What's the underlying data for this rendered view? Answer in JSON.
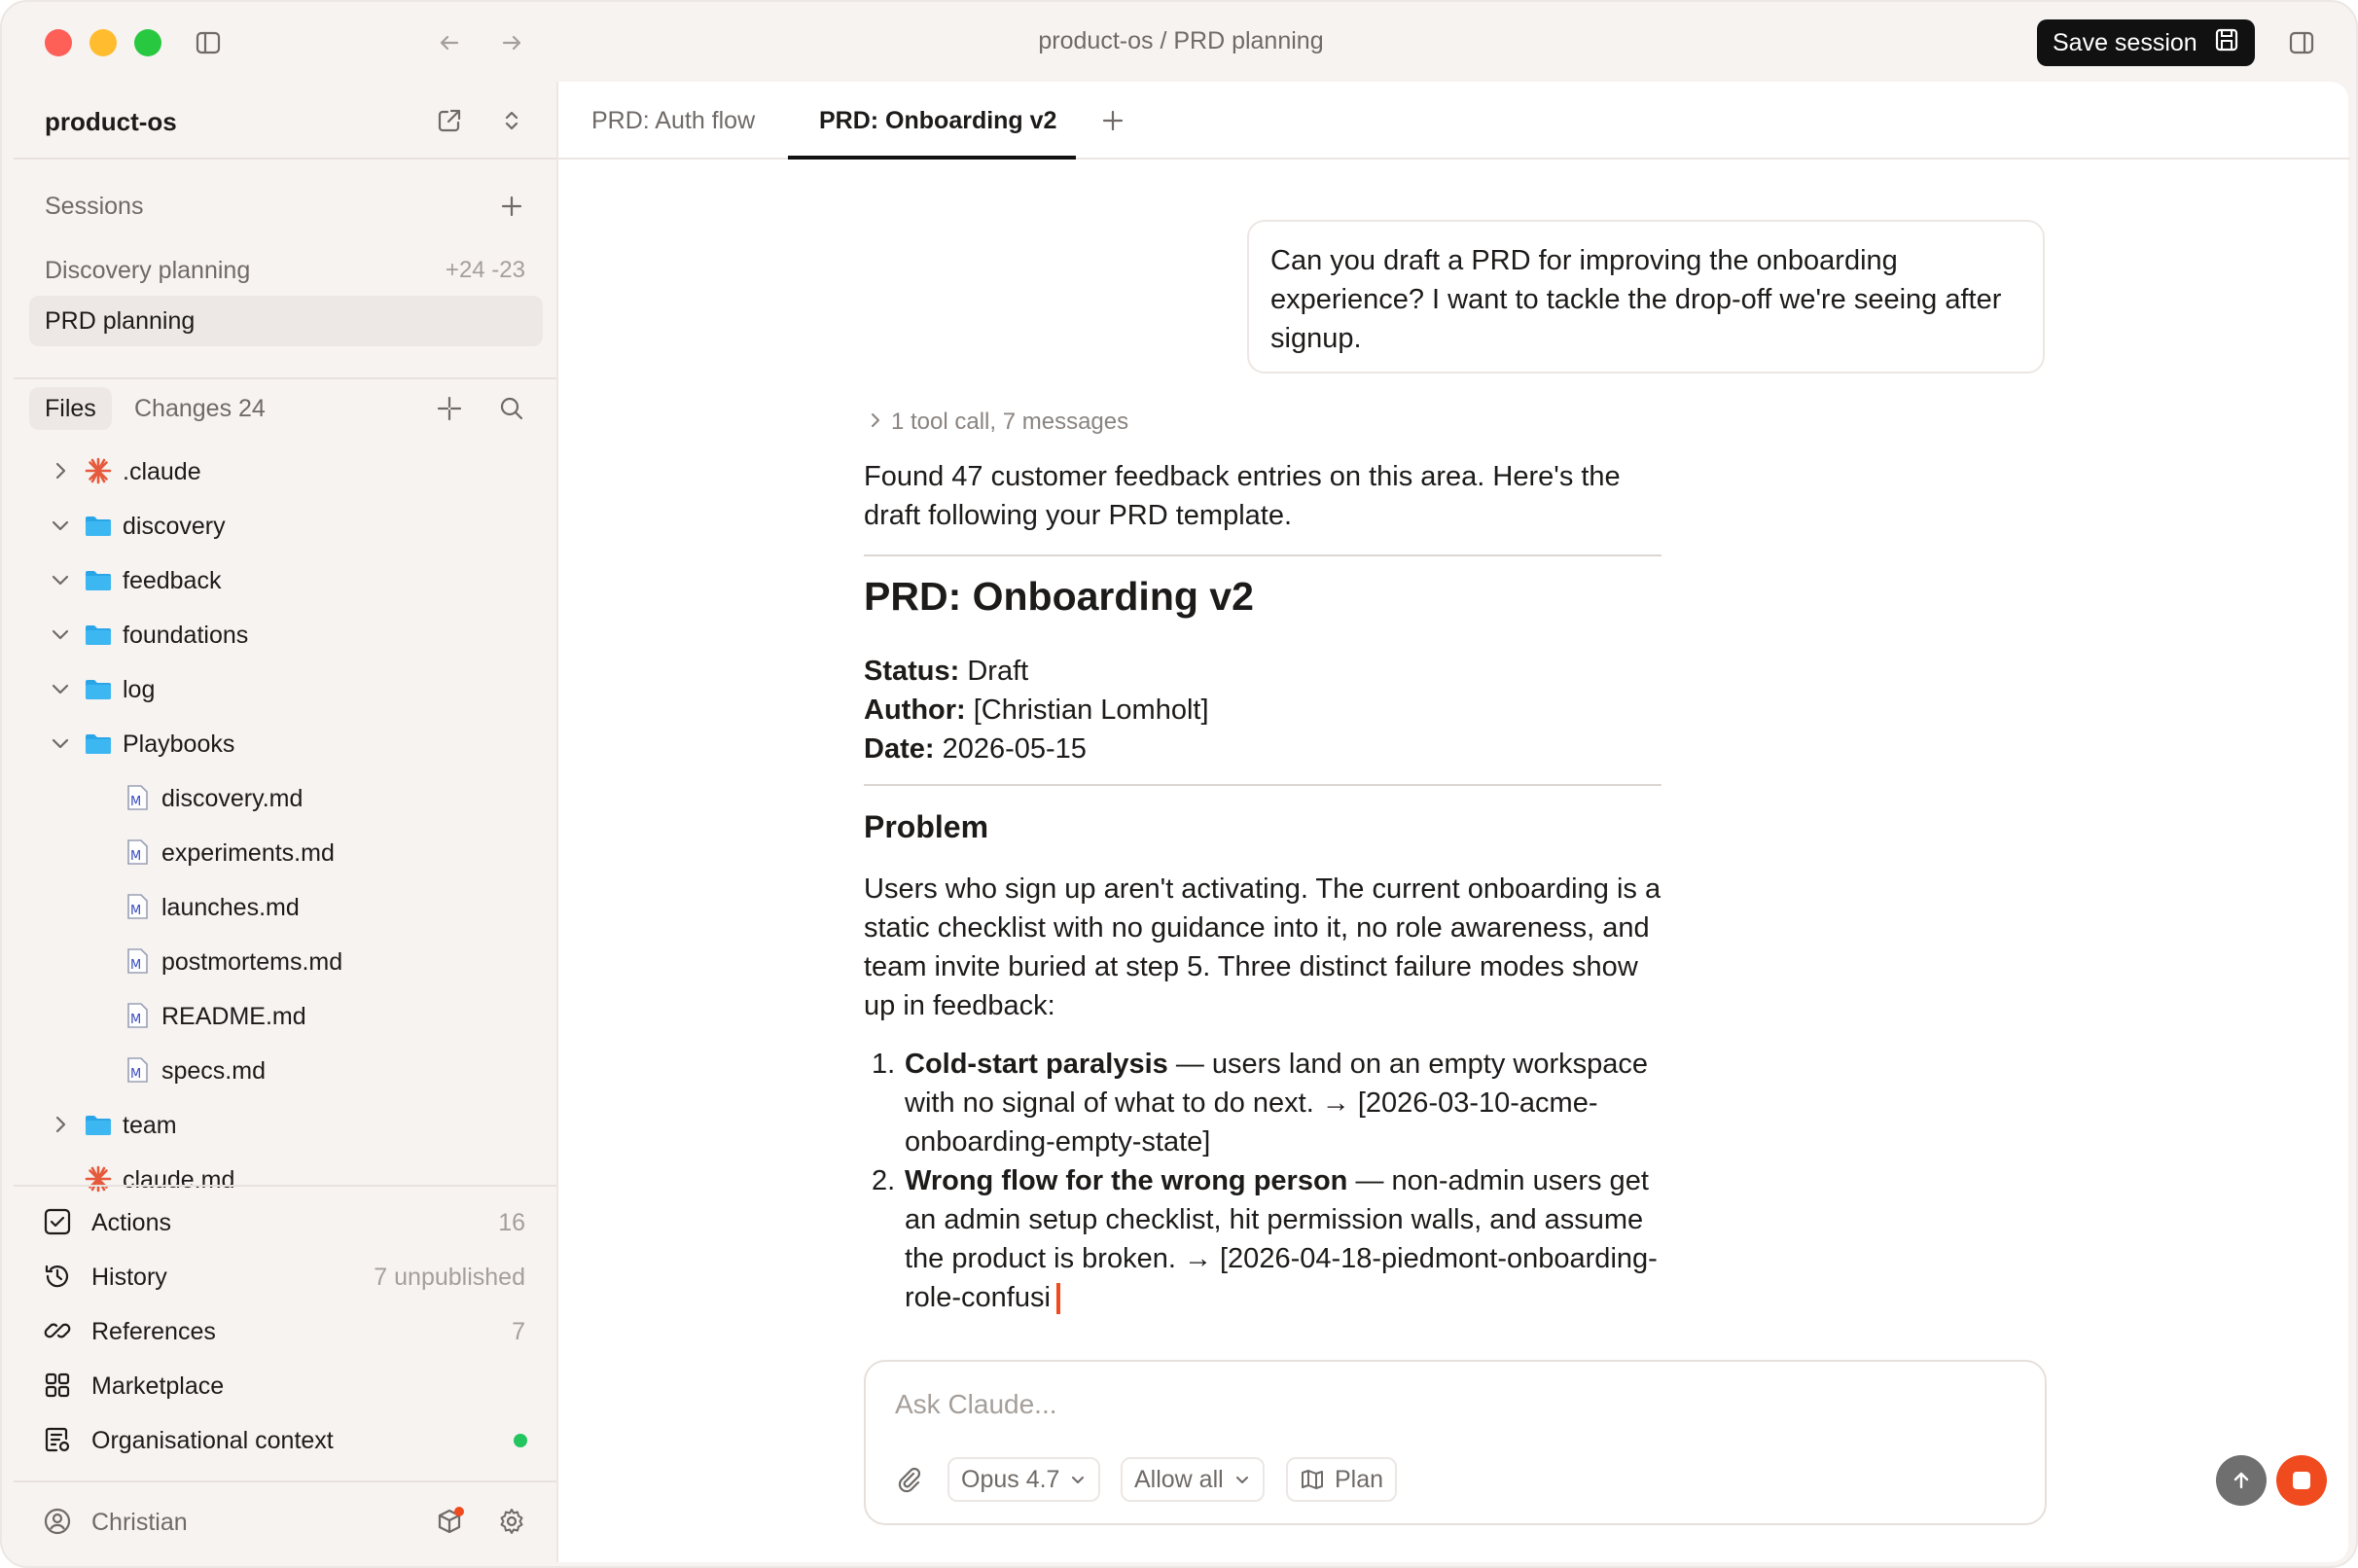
{
  "window": {
    "title": "product-os / PRD planning",
    "save_session_label": "Save session"
  },
  "sidebar": {
    "project_name": "product-os",
    "sessions_label": "Sessions",
    "sessions": [
      {
        "label": "Discovery planning",
        "diff": "+24 -23"
      },
      {
        "label": "PRD planning",
        "diff": ""
      }
    ],
    "files_tab": "Files",
    "changes_tab": "Changes 24",
    "tree": [
      {
        "label": ".claude",
        "kind": "claude",
        "chevron": "right"
      },
      {
        "label": "discovery",
        "kind": "folder",
        "chevron": "down"
      },
      {
        "label": "feedback",
        "kind": "folder",
        "chevron": "down"
      },
      {
        "label": "foundations",
        "kind": "folder",
        "chevron": "down"
      },
      {
        "label": "log",
        "kind": "folder",
        "chevron": "down"
      },
      {
        "label": "Playbooks",
        "kind": "folder",
        "chevron": "down"
      },
      {
        "label": "discovery.md",
        "kind": "md"
      },
      {
        "label": "experiments.md",
        "kind": "md"
      },
      {
        "label": "launches.md",
        "kind": "md"
      },
      {
        "label": "postmortems.md",
        "kind": "md"
      },
      {
        "label": "README.md",
        "kind": "md"
      },
      {
        "label": "specs.md",
        "kind": "md"
      },
      {
        "label": "team",
        "kind": "folder",
        "chevron": "right"
      },
      {
        "label": "claude.md",
        "kind": "claude"
      }
    ],
    "nav": [
      {
        "label": "Actions",
        "count": "16",
        "icon": "checkbox-icon"
      },
      {
        "label": "History",
        "count": "7 unpublished",
        "icon": "history-icon"
      },
      {
        "label": "References",
        "count": "7",
        "icon": "link-icon"
      },
      {
        "label": "Marketplace",
        "count": "",
        "icon": "grid-icon"
      },
      {
        "label": "Organisational context",
        "count": "",
        "icon": "context-icon"
      }
    ],
    "user_name": "Christian"
  },
  "tabs": [
    {
      "label": "PRD: Auth flow",
      "active": false
    },
    {
      "label": "PRD: Onboarding v2",
      "active": true
    }
  ],
  "conversation": {
    "user_message": "Can you draft a PRD for improving the onboarding experience? I want to tackle the drop-off we're seeing after signup.",
    "tool_summary": "1 tool call, 7 messages",
    "intro": "Found 47 customer feedback entries on this area. Here's the draft following your PRD template.",
    "doc_title": "PRD: Onboarding v2",
    "status_label": "Status:",
    "status_value": " Draft",
    "author_label": "Author:",
    "author_value": " [Christian Lomholt]",
    "date_label": "Date:",
    "date_value": " 2026-05-15",
    "problem_heading": "Problem",
    "problem_text": "Users who sign up aren't activating. The current onboarding is a static checklist with no guidance into it, no role awareness, and team invite buried at step 5. Three distinct failure modes show up in feedback:",
    "list": [
      {
        "num": "1.",
        "bold": "Cold-start paralysis",
        "rest": " — users land on an empty workspace with no signal of what to do next. → [2026-03-10-acme-onboarding-empty-state]"
      },
      {
        "num": "2.",
        "bold": "Wrong flow for the wrong person",
        "rest": " — non-admin users get an admin setup checklist, hit permission walls, and assume the product is broken. → [2026-04-18-piedmont-onboarding-role-confusi"
      }
    ]
  },
  "composer": {
    "placeholder": "Ask Claude...",
    "model": "Opus 4.7",
    "permission": "Allow all",
    "plan": "Plan"
  },
  "colors": {
    "accent_stop": "#f04b1e",
    "status_online": "#22c55e",
    "folder": "#2aa6e8"
  }
}
